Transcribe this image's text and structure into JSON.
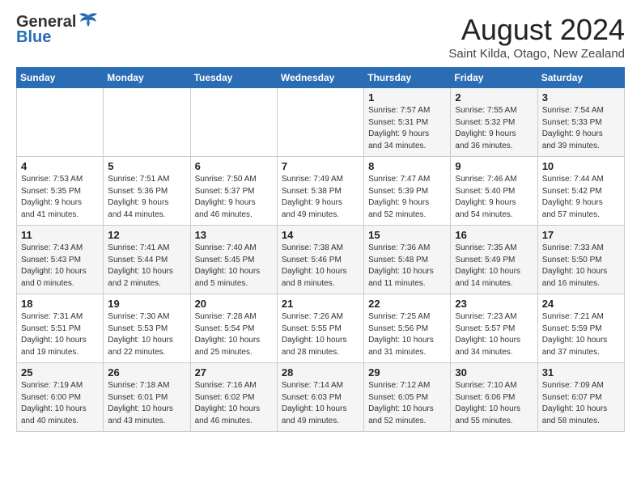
{
  "logo": {
    "general": "General",
    "blue": "Blue"
  },
  "title": "August 2024",
  "location": "Saint Kilda, Otago, New Zealand",
  "days_of_week": [
    "Sunday",
    "Monday",
    "Tuesday",
    "Wednesday",
    "Thursday",
    "Friday",
    "Saturday"
  ],
  "weeks": [
    [
      {
        "day": "",
        "info": ""
      },
      {
        "day": "",
        "info": ""
      },
      {
        "day": "",
        "info": ""
      },
      {
        "day": "",
        "info": ""
      },
      {
        "day": "1",
        "info": "Sunrise: 7:57 AM\nSunset: 5:31 PM\nDaylight: 9 hours\nand 34 minutes."
      },
      {
        "day": "2",
        "info": "Sunrise: 7:55 AM\nSunset: 5:32 PM\nDaylight: 9 hours\nand 36 minutes."
      },
      {
        "day": "3",
        "info": "Sunrise: 7:54 AM\nSunset: 5:33 PM\nDaylight: 9 hours\nand 39 minutes."
      }
    ],
    [
      {
        "day": "4",
        "info": "Sunrise: 7:53 AM\nSunset: 5:35 PM\nDaylight: 9 hours\nand 41 minutes."
      },
      {
        "day": "5",
        "info": "Sunrise: 7:51 AM\nSunset: 5:36 PM\nDaylight: 9 hours\nand 44 minutes."
      },
      {
        "day": "6",
        "info": "Sunrise: 7:50 AM\nSunset: 5:37 PM\nDaylight: 9 hours\nand 46 minutes."
      },
      {
        "day": "7",
        "info": "Sunrise: 7:49 AM\nSunset: 5:38 PM\nDaylight: 9 hours\nand 49 minutes."
      },
      {
        "day": "8",
        "info": "Sunrise: 7:47 AM\nSunset: 5:39 PM\nDaylight: 9 hours\nand 52 minutes."
      },
      {
        "day": "9",
        "info": "Sunrise: 7:46 AM\nSunset: 5:40 PM\nDaylight: 9 hours\nand 54 minutes."
      },
      {
        "day": "10",
        "info": "Sunrise: 7:44 AM\nSunset: 5:42 PM\nDaylight: 9 hours\nand 57 minutes."
      }
    ],
    [
      {
        "day": "11",
        "info": "Sunrise: 7:43 AM\nSunset: 5:43 PM\nDaylight: 10 hours\nand 0 minutes."
      },
      {
        "day": "12",
        "info": "Sunrise: 7:41 AM\nSunset: 5:44 PM\nDaylight: 10 hours\nand 2 minutes."
      },
      {
        "day": "13",
        "info": "Sunrise: 7:40 AM\nSunset: 5:45 PM\nDaylight: 10 hours\nand 5 minutes."
      },
      {
        "day": "14",
        "info": "Sunrise: 7:38 AM\nSunset: 5:46 PM\nDaylight: 10 hours\nand 8 minutes."
      },
      {
        "day": "15",
        "info": "Sunrise: 7:36 AM\nSunset: 5:48 PM\nDaylight: 10 hours\nand 11 minutes."
      },
      {
        "day": "16",
        "info": "Sunrise: 7:35 AM\nSunset: 5:49 PM\nDaylight: 10 hours\nand 14 minutes."
      },
      {
        "day": "17",
        "info": "Sunrise: 7:33 AM\nSunset: 5:50 PM\nDaylight: 10 hours\nand 16 minutes."
      }
    ],
    [
      {
        "day": "18",
        "info": "Sunrise: 7:31 AM\nSunset: 5:51 PM\nDaylight: 10 hours\nand 19 minutes."
      },
      {
        "day": "19",
        "info": "Sunrise: 7:30 AM\nSunset: 5:53 PM\nDaylight: 10 hours\nand 22 minutes."
      },
      {
        "day": "20",
        "info": "Sunrise: 7:28 AM\nSunset: 5:54 PM\nDaylight: 10 hours\nand 25 minutes."
      },
      {
        "day": "21",
        "info": "Sunrise: 7:26 AM\nSunset: 5:55 PM\nDaylight: 10 hours\nand 28 minutes."
      },
      {
        "day": "22",
        "info": "Sunrise: 7:25 AM\nSunset: 5:56 PM\nDaylight: 10 hours\nand 31 minutes."
      },
      {
        "day": "23",
        "info": "Sunrise: 7:23 AM\nSunset: 5:57 PM\nDaylight: 10 hours\nand 34 minutes."
      },
      {
        "day": "24",
        "info": "Sunrise: 7:21 AM\nSunset: 5:59 PM\nDaylight: 10 hours\nand 37 minutes."
      }
    ],
    [
      {
        "day": "25",
        "info": "Sunrise: 7:19 AM\nSunset: 6:00 PM\nDaylight: 10 hours\nand 40 minutes."
      },
      {
        "day": "26",
        "info": "Sunrise: 7:18 AM\nSunset: 6:01 PM\nDaylight: 10 hours\nand 43 minutes."
      },
      {
        "day": "27",
        "info": "Sunrise: 7:16 AM\nSunset: 6:02 PM\nDaylight: 10 hours\nand 46 minutes."
      },
      {
        "day": "28",
        "info": "Sunrise: 7:14 AM\nSunset: 6:03 PM\nDaylight: 10 hours\nand 49 minutes."
      },
      {
        "day": "29",
        "info": "Sunrise: 7:12 AM\nSunset: 6:05 PM\nDaylight: 10 hours\nand 52 minutes."
      },
      {
        "day": "30",
        "info": "Sunrise: 7:10 AM\nSunset: 6:06 PM\nDaylight: 10 hours\nand 55 minutes."
      },
      {
        "day": "31",
        "info": "Sunrise: 7:09 AM\nSunset: 6:07 PM\nDaylight: 10 hours\nand 58 minutes."
      }
    ]
  ]
}
